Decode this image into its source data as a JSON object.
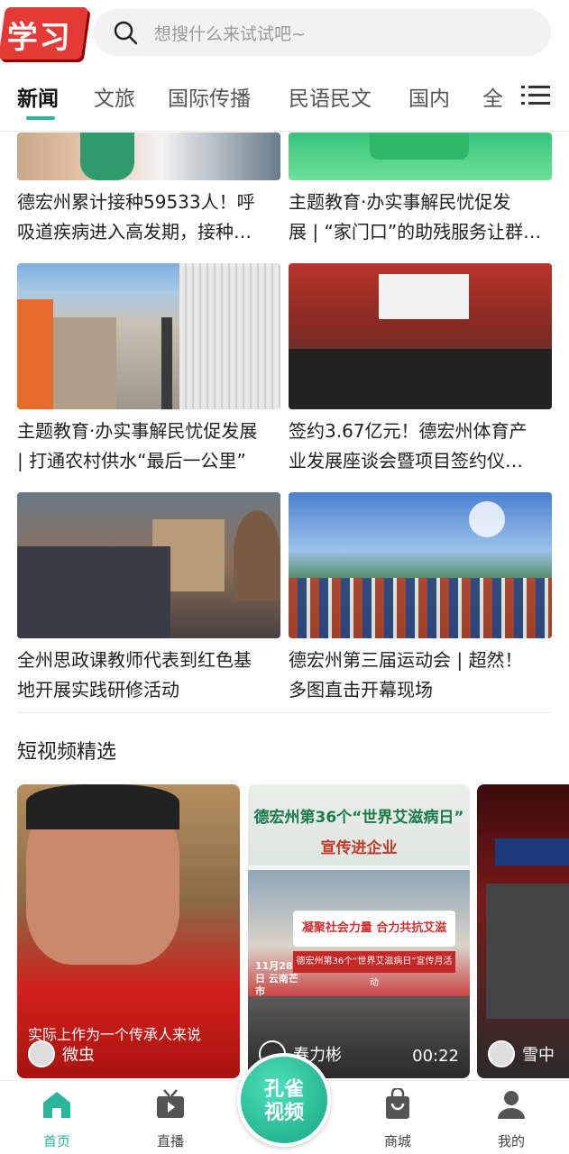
{
  "header": {
    "logo_text": "学习",
    "search_placeholder": "想搜什么来试试吧~"
  },
  "tabs": [
    {
      "label": "新闻"
    },
    {
      "label": "文旅"
    },
    {
      "label": "国际传播"
    },
    {
      "label": "民语民文"
    },
    {
      "label": "国内"
    },
    {
      "label": "全"
    }
  ],
  "news": [
    {
      "line1": "德宏州累计接种59533人！呼",
      "line2": "吸道疾病进入高发期，接种…"
    },
    {
      "line1": "主题教育·办实事解民忧促发",
      "line2": "展 | “家门口”的助残服务让群…"
    },
    {
      "line1": "主题教育·办实事解民忧促发展",
      "line2": "| 打通农村供水“最后一公里”"
    },
    {
      "line1": "签约3.67亿元！德宏州体育产",
      "line2": "业发展座谈会暨项目签约仪…"
    },
    {
      "line1": "全州思政课教师代表到红色基",
      "line2": "地开展实践研修活动"
    },
    {
      "line1": "德宏州第三届运动会 | 超然！",
      "line2": "多图直击开幕现场"
    }
  ],
  "short_video": {
    "section_title": "短视频精选",
    "items": [
      {
        "caption": "实际上作为一个传承人来说",
        "author": "微虫",
        "duration": ""
      },
      {
        "caption": "",
        "author": "春力彬",
        "duration": "00:22",
        "headline1": "德宏州第36个“世界艾滋病日”",
        "headline2": "宣传进企业",
        "banner": "凝聚社会力量 合力共抗艾滋",
        "banner2": "德宏州第36个“世界艾滋病日”宣传月活动",
        "date": "11月28日 云南芒市"
      },
      {
        "caption": "",
        "author": "雪中",
        "duration": ""
      }
    ]
  },
  "bottom_nav": [
    {
      "label": "首页"
    },
    {
      "label": "直播"
    },
    {
      "label": "商城"
    },
    {
      "label": "我的"
    }
  ],
  "center_button": {
    "line1": "孔雀",
    "line2": "视频"
  },
  "colors": {
    "accent": "#2bb59b",
    "logo_red": "#e53935"
  }
}
